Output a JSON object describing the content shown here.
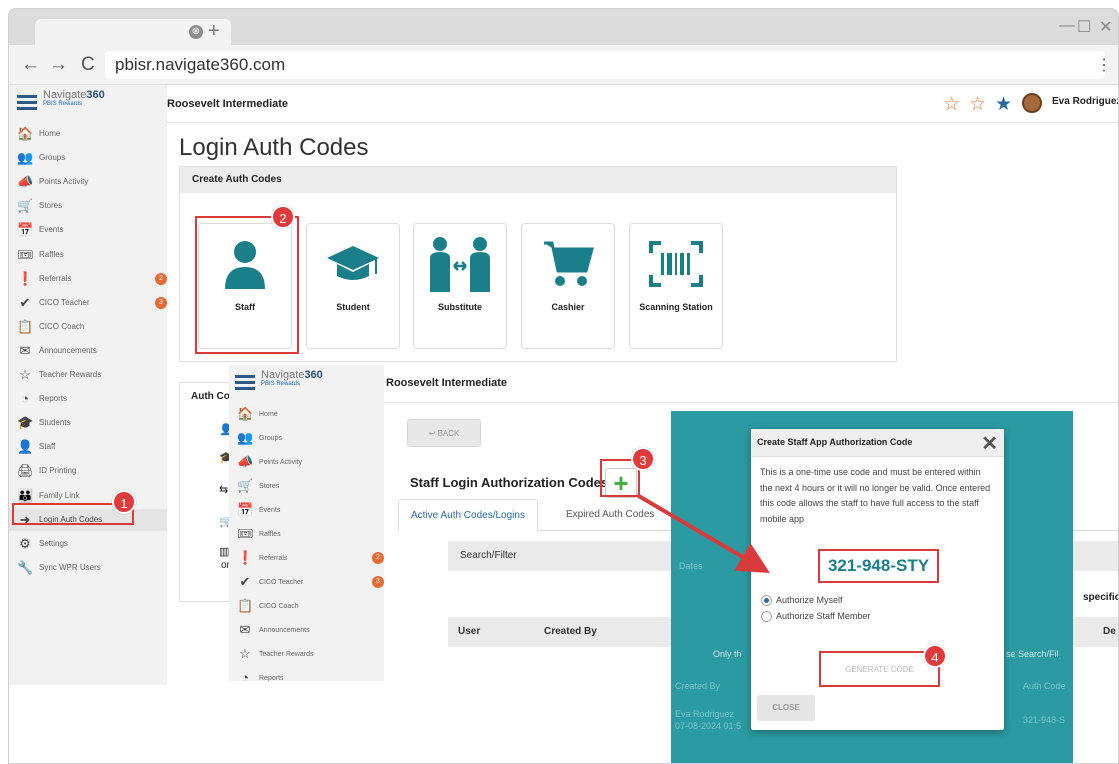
{
  "browser": {
    "url": "pbisr.navigate360.com",
    "tab_close_icon": "⊗",
    "new_tab_icon": "+",
    "back_icon": "←",
    "forward_icon": "→",
    "reload_icon": "C",
    "menu_icon": "⋮",
    "minimize_icon": "—",
    "maximize_icon": "☐",
    "close_icon": "✕"
  },
  "brand": {
    "name_part1": "Navigate",
    "name_part2": "360",
    "sub": "PBIS Rewards"
  },
  "sidebar": {
    "items": [
      {
        "label": "Home",
        "icon": "🏠"
      },
      {
        "label": "Groups",
        "icon": "👥"
      },
      {
        "label": "Points Activity",
        "icon": "📣"
      },
      {
        "label": "Stores",
        "icon": "🛒"
      },
      {
        "label": "Events",
        "icon": "📅"
      },
      {
        "label": "Raffles",
        "icon": "🎟"
      },
      {
        "label": "Referrals",
        "icon": "❗",
        "badge": "2"
      },
      {
        "label": "CICO Teacher",
        "icon": "✔",
        "badge": "3"
      },
      {
        "label": "CICO Coach",
        "icon": "📋"
      },
      {
        "label": "Announcements",
        "icon": "✉"
      },
      {
        "label": "Teacher Rewards",
        "icon": "☆"
      },
      {
        "label": "Reports",
        "icon": "◔"
      },
      {
        "label": "Students",
        "icon": "🎓"
      },
      {
        "label": "Staff",
        "icon": "👤"
      },
      {
        "label": "ID Printing",
        "icon": "🖨"
      },
      {
        "label": "Family Link",
        "icon": "👪"
      },
      {
        "label": "Login Auth Codes",
        "icon": "➜"
      },
      {
        "label": "Settings",
        "icon": "⚙"
      },
      {
        "label": "Sync WPR Users",
        "icon": "🔧"
      }
    ]
  },
  "topbar": {
    "school": "Roosevelt Intermediate",
    "user": "Eva Rodriguez",
    "stars": [
      "☆",
      "☆",
      "★"
    ]
  },
  "page": {
    "title": "Login Auth Codes",
    "create_header": "Create Auth Codes",
    "cards": [
      {
        "label": "Staff"
      },
      {
        "label": "Student"
      },
      {
        "label": "Substitute"
      },
      {
        "label": "Cashier"
      },
      {
        "label": "Scanning Station"
      }
    ],
    "auth_header": "Auth Co",
    "auth_fragment": "orde"
  },
  "inner": {
    "sidebar_items": [
      {
        "label": "Home",
        "icon": "🏠"
      },
      {
        "label": "Groups",
        "icon": "👥"
      },
      {
        "label": "Points Activity",
        "icon": "📣"
      },
      {
        "label": "Stores",
        "icon": "🛒"
      },
      {
        "label": "Events",
        "icon": "📅"
      },
      {
        "label": "Raffles",
        "icon": "🎟"
      },
      {
        "label": "Referrals",
        "icon": "❗",
        "badge": "2"
      },
      {
        "label": "CICO Teacher",
        "icon": "✔",
        "badge": "3"
      },
      {
        "label": "CICO Coach",
        "icon": "📋"
      },
      {
        "label": "Announcements",
        "icon": "✉"
      },
      {
        "label": "Teacher Rewards",
        "icon": "☆"
      },
      {
        "label": "Reports",
        "icon": "◔"
      }
    ],
    "back": "BACK",
    "staff_codes_title": "Staff Login Authorization Codes",
    "plus": "+",
    "tabs": [
      "Active Auth Codes/Logins",
      "Expired Auth Codes"
    ],
    "search": "Search/Filter",
    "columns": [
      "User",
      "Created By",
      "De"
    ],
    "specific": "specific r",
    "bg_texts": [
      "Dates",
      "Only th",
      "se Search/Fil",
      "Created By",
      "Auth Code",
      "Eva Rodriguez",
      "07-08-2024 01:5",
      "321-948-S"
    ]
  },
  "modal": {
    "title": "Create Staff App Authorization Code",
    "close_x": "✕",
    "description": "This is a one-time use code and must be entered within the next 4 hours or it will no longer be valid. Once entered this code allows the staff to have full access to the staff mobile app",
    "code": "321-948-STY",
    "options": [
      "Authorize Myself",
      "Authorize Staff Member"
    ],
    "selected_option": "Authorize Myself",
    "generate": "GENERATE CODE",
    "close": "CLOSE"
  },
  "steps": [
    "1",
    "2",
    "3",
    "4"
  ],
  "colors": {
    "accent": "#1b7f8a",
    "teal": "#2b9aa2",
    "highlight": "#d93b3b",
    "plus": "#3fae3a",
    "badge": "#e56a33"
  }
}
